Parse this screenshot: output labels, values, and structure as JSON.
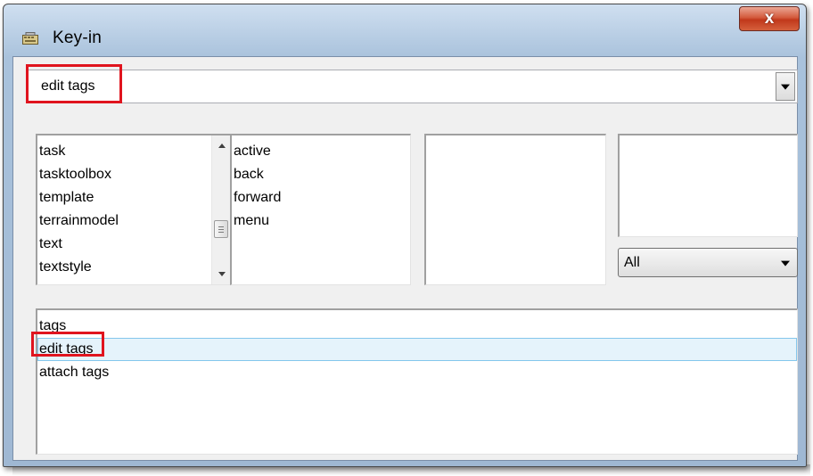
{
  "window": {
    "title": "Key-in",
    "close_label": "x",
    "icon": "keyboard-icon"
  },
  "keyin": {
    "value": "edit tags"
  },
  "lists": {
    "commands": [
      "task",
      "tasktoolbox",
      "template",
      "terrainmodel",
      "text",
      "textstyle"
    ],
    "subcommands": [
      "active",
      "back",
      "forward",
      "menu"
    ],
    "list3": [],
    "list4": []
  },
  "filter": {
    "selected": "All"
  },
  "history": {
    "items": [
      "tags",
      "edit tags",
      "attach tags"
    ],
    "selected_index": 1
  },
  "colors": {
    "highlight_box": "#e0141e",
    "selection_bg": "#e5f3fb",
    "selection_border": "#84c7ec",
    "close_button": "#c1381b"
  }
}
